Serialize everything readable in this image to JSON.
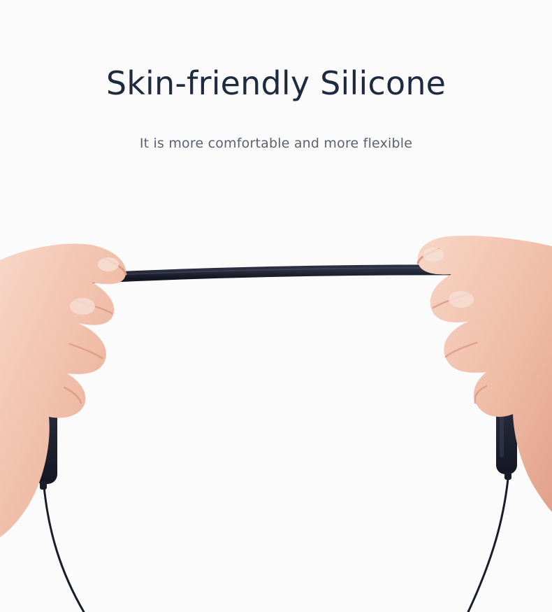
{
  "hero": {
    "title": "Skin-friendly Silicone",
    "subtitle": "It is more comfortable and more flexible"
  },
  "colors": {
    "background": "#fbfbfc",
    "title": "#1e2a3e",
    "subtitle": "#5c6170",
    "cable": "#1c1f2b",
    "skin": "#f4c9b6",
    "skin_shadow": "#e2a994"
  },
  "illustration": {
    "left_hand_icon": "left-hand-icon",
    "right_hand_icon": "right-hand-icon",
    "cable_icon": "silicone-cable-icon",
    "earbud_icon": "earbud-housing-icon"
  }
}
